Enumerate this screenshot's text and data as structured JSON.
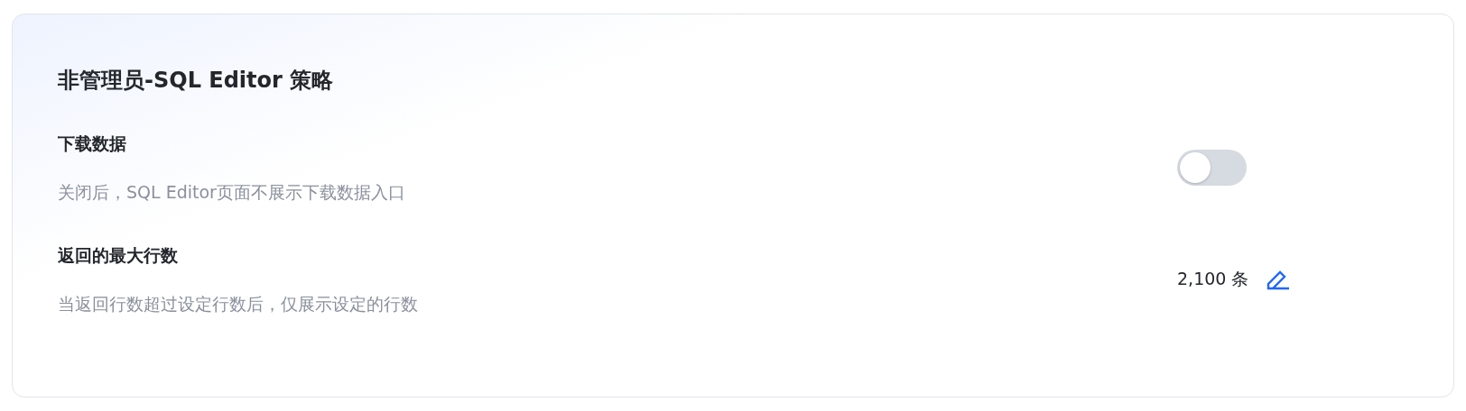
{
  "card": {
    "title": "非管理员-SQL Editor 策略",
    "settings": [
      {
        "kind": "toggle",
        "label": "下载数据",
        "description": "关闭后，SQL Editor页面不展示下载数据入口",
        "on": false
      },
      {
        "kind": "value",
        "label": "返回的最大行数",
        "description": "当返回行数超过设定行数后，仅展示设定的行数",
        "value": "2,100 条"
      }
    ]
  }
}
